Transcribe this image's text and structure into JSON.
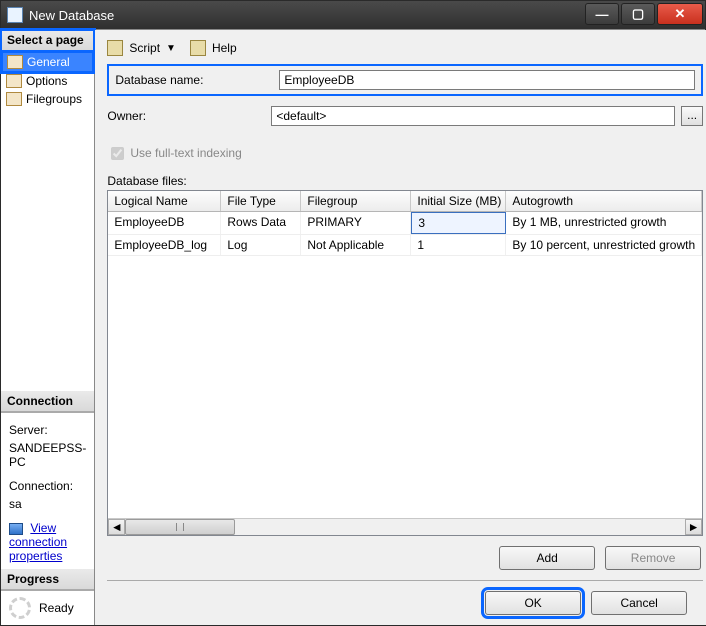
{
  "window": {
    "title": "New Database"
  },
  "sidebar": {
    "select_page_label": "Select a page",
    "items": [
      {
        "label": "General"
      },
      {
        "label": "Options"
      },
      {
        "label": "Filegroups"
      }
    ],
    "connection_label": "Connection",
    "server_label": "Server:",
    "server_value": "SANDEEPSS-PC",
    "conn_label": "Connection:",
    "conn_value": "sa",
    "view_props_label": "View connection properties",
    "progress_label": "Progress",
    "progress_value": "Ready"
  },
  "toolbar": {
    "script_label": "Script",
    "help_label": "Help"
  },
  "form": {
    "dbname_label": "Database name:",
    "dbname_value": "EmployeeDB",
    "owner_label": "Owner:",
    "owner_value": "<default>",
    "fulltext_label": "Use full-text indexing",
    "files_label": "Database files:"
  },
  "grid": {
    "headers": [
      "Logical Name",
      "File Type",
      "Filegroup",
      "Initial Size (MB)",
      "Autogrowth"
    ],
    "rows": [
      {
        "c1": "EmployeeDB",
        "c2": "Rows Data",
        "c3": "PRIMARY",
        "c4": "3",
        "c5": "By 1 MB, unrestricted growth"
      },
      {
        "c1": "EmployeeDB_log",
        "c2": "Log",
        "c3": "Not Applicable",
        "c4": "1",
        "c5": "By 10 percent, unrestricted growth"
      }
    ]
  },
  "buttons": {
    "add": "Add",
    "remove": "Remove",
    "ok": "OK",
    "cancel": "Cancel"
  }
}
